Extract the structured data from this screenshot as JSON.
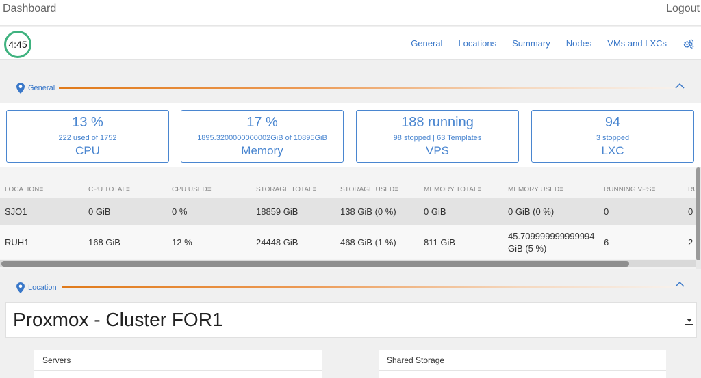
{
  "header": {
    "title": "Dashboard",
    "logout_label": "Logout"
  },
  "timer": "4:45",
  "nav": {
    "items": [
      "General",
      "Locations",
      "Summary",
      "Nodes",
      "VMs and LXCs"
    ],
    "settings_icon": "gears-icon"
  },
  "sections": {
    "general": "General",
    "location": "Location"
  },
  "cards": [
    {
      "big": "13 %",
      "small": "222 used of 1752",
      "name": "CPU"
    },
    {
      "big": "17 %",
      "small": "1895.3200000000002GiB of 10895GiB",
      "name": "Memory"
    },
    {
      "big": "188 running",
      "small": "98 stopped | 63 Templates",
      "name": "VPS"
    },
    {
      "big": "94",
      "small": "3 stopped",
      "name": "LXC"
    }
  ],
  "table": {
    "columns": [
      "LOCATION",
      "CPU TOTAL",
      "CPU USED",
      "STORAGE TOTAL",
      "STORAGE USED",
      "MEMORY TOTAL",
      "MEMORY USED",
      "RUNNING VPS",
      "RU"
    ],
    "rows": [
      [
        "SJO1",
        "0 GiB",
        "0 %",
        "18859 GiB",
        "138 GiB (0 %)",
        "0 GiB",
        "0 GiB (0 %)",
        "0",
        "0"
      ],
      [
        "RUH1",
        "168 GiB",
        "12 %",
        "24448 GiB",
        "468 GiB (1 %)",
        "811 GiB",
        "45.709999999999994 GiB (5 %)",
        "6",
        "2"
      ]
    ]
  },
  "cluster": {
    "title": "Proxmox - Cluster FOR1"
  },
  "panels": {
    "servers": "Servers",
    "shared_storage": "Shared Storage"
  },
  "colors": {
    "accent": "#3a78c9",
    "orange": "#e07a1a",
    "timer_ring": "#3fb27f"
  }
}
